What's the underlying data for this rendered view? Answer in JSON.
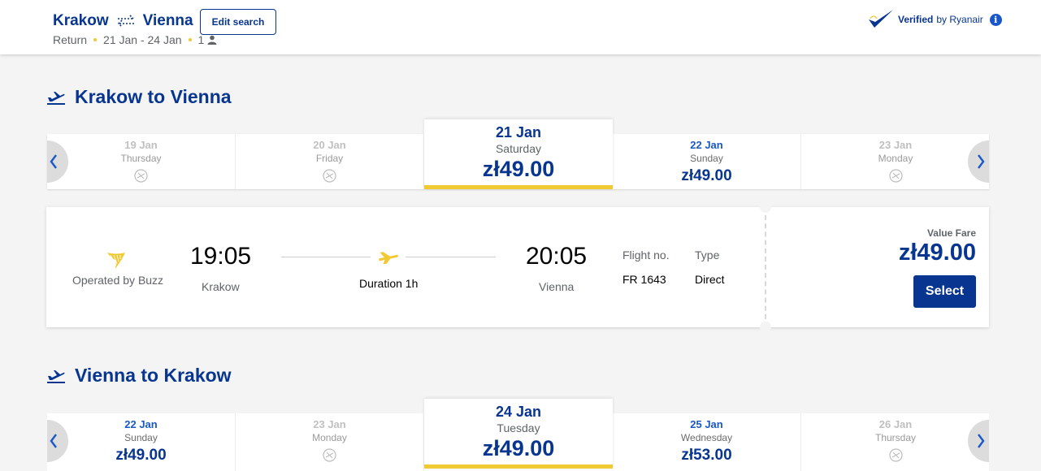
{
  "header": {
    "origin": "Krakow",
    "destination": "Vienna",
    "edit_label": "Edit search",
    "trip_type": "Return",
    "dates": "21 Jan - 24 Jan",
    "passengers": "1",
    "verified_label": "Verified",
    "verified_by": "by Ryanair",
    "info_glyph": "i"
  },
  "outbound": {
    "title": "Krakow to Vienna",
    "days": [
      {
        "date": "19 Jan",
        "weekday": "Thursday",
        "price": null
      },
      {
        "date": "20 Jan",
        "weekday": "Friday",
        "price": null
      },
      {
        "date": "21 Jan",
        "weekday": "Saturday",
        "price": "zł49.00"
      },
      {
        "date": "22 Jan",
        "weekday": "Sunday",
        "price": "zł49.00"
      },
      {
        "date": "23 Jan",
        "weekday": "Monday",
        "price": null
      }
    ],
    "selected_index": 2
  },
  "flight": {
    "operator": "Operated by Buzz",
    "depart_time": "19:05",
    "depart_city": "Krakow",
    "duration": "Duration 1h",
    "arrive_time": "20:05",
    "arrive_city": "Vienna",
    "flight_no_label": "Flight no.",
    "flight_no": "FR 1643",
    "type_label": "Type",
    "type": "Direct",
    "fare_label": "Value Fare",
    "fare_price": "zł49.00",
    "select_label": "Select"
  },
  "return": {
    "title": "Vienna to Krakow",
    "days": [
      {
        "date": "22 Jan",
        "weekday": "Sunday",
        "price": "zł49.00"
      },
      {
        "date": "23 Jan",
        "weekday": "Monday",
        "price": null
      },
      {
        "date": "24 Jan",
        "weekday": "Tuesday",
        "price": "zł49.00"
      },
      {
        "date": "25 Jan",
        "weekday": "Wednesday",
        "price": "zł53.00"
      },
      {
        "date": "26 Jan",
        "weekday": "Thursday",
        "price": null
      }
    ],
    "selected_index": 2
  },
  "colors": {
    "brand_blue": "#073590",
    "accent_yellow": "#f1c933",
    "link_blue": "#1a57c9"
  },
  "icons": {
    "swap": "swap-arrows-icon",
    "person": "person-icon",
    "verified": "checkmark-harp-icon",
    "info": "info-icon",
    "departure": "plane-takeoff-icon",
    "no_flight": "no-flight-icon",
    "operator": "ryanair-harp-logo",
    "plane": "plane-icon",
    "prev": "chevron-left-icon",
    "next": "chevron-right-icon"
  }
}
